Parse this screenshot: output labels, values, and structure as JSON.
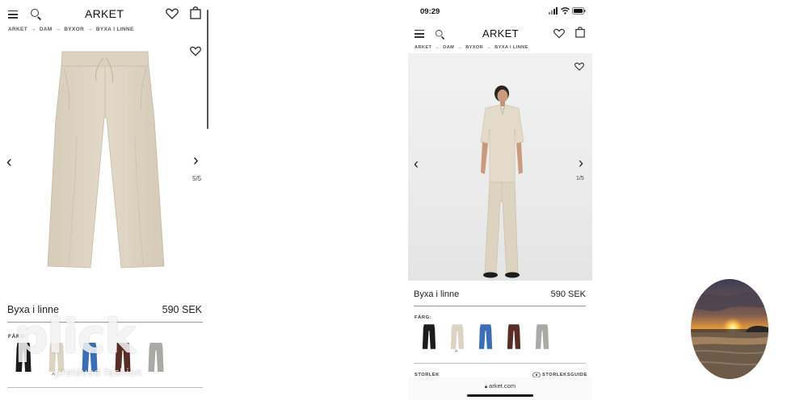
{
  "left_screen": {
    "header": {
      "logo": "ARKET",
      "icons": [
        "menu-icon",
        "search-icon",
        "heart-icon",
        "bag-icon"
      ]
    },
    "breadcrumb": [
      "ARKET",
      "DAM",
      "BYXOR",
      "BYXA I LINNE"
    ],
    "gallery": {
      "counter": "5/5"
    },
    "product": {
      "name": "Byxa i linne",
      "price": "590 SEK"
    },
    "color_label": "FÄRG:",
    "watermark": {
      "main": "plick",
      "sub": "preloved fashion"
    }
  },
  "right_screen": {
    "status_bar": {
      "time": "09:29"
    },
    "header": {
      "logo": "ARKET",
      "icons": [
        "menu-icon",
        "search-icon",
        "heart-icon",
        "bag-icon"
      ]
    },
    "breadcrumb": [
      "ARKET",
      "DAM",
      "BYXOR",
      "BYXA I LINNE"
    ],
    "gallery": {
      "counter": "1/5"
    },
    "product": {
      "name": "Byxa i linne",
      "price": "590 SEK"
    },
    "color_label": "FÄRG:",
    "size_label": "STORLEK",
    "size_guide": "STORLEKSGUIDE",
    "url": "arket.com"
  },
  "swatches": [
    {
      "name": "black",
      "color": "#1c1c1c"
    },
    {
      "name": "beige",
      "color": "#ddd3c2"
    },
    {
      "name": "blue",
      "color": "#3b6fb5"
    },
    {
      "name": "brown",
      "color": "#5a2d24"
    },
    {
      "name": "grey",
      "color": "#a9a9a6"
    }
  ],
  "colors": {
    "linen": "#ddd4c4",
    "linen_shadow": "#cbbfac",
    "rule": "#bdbdbd"
  }
}
